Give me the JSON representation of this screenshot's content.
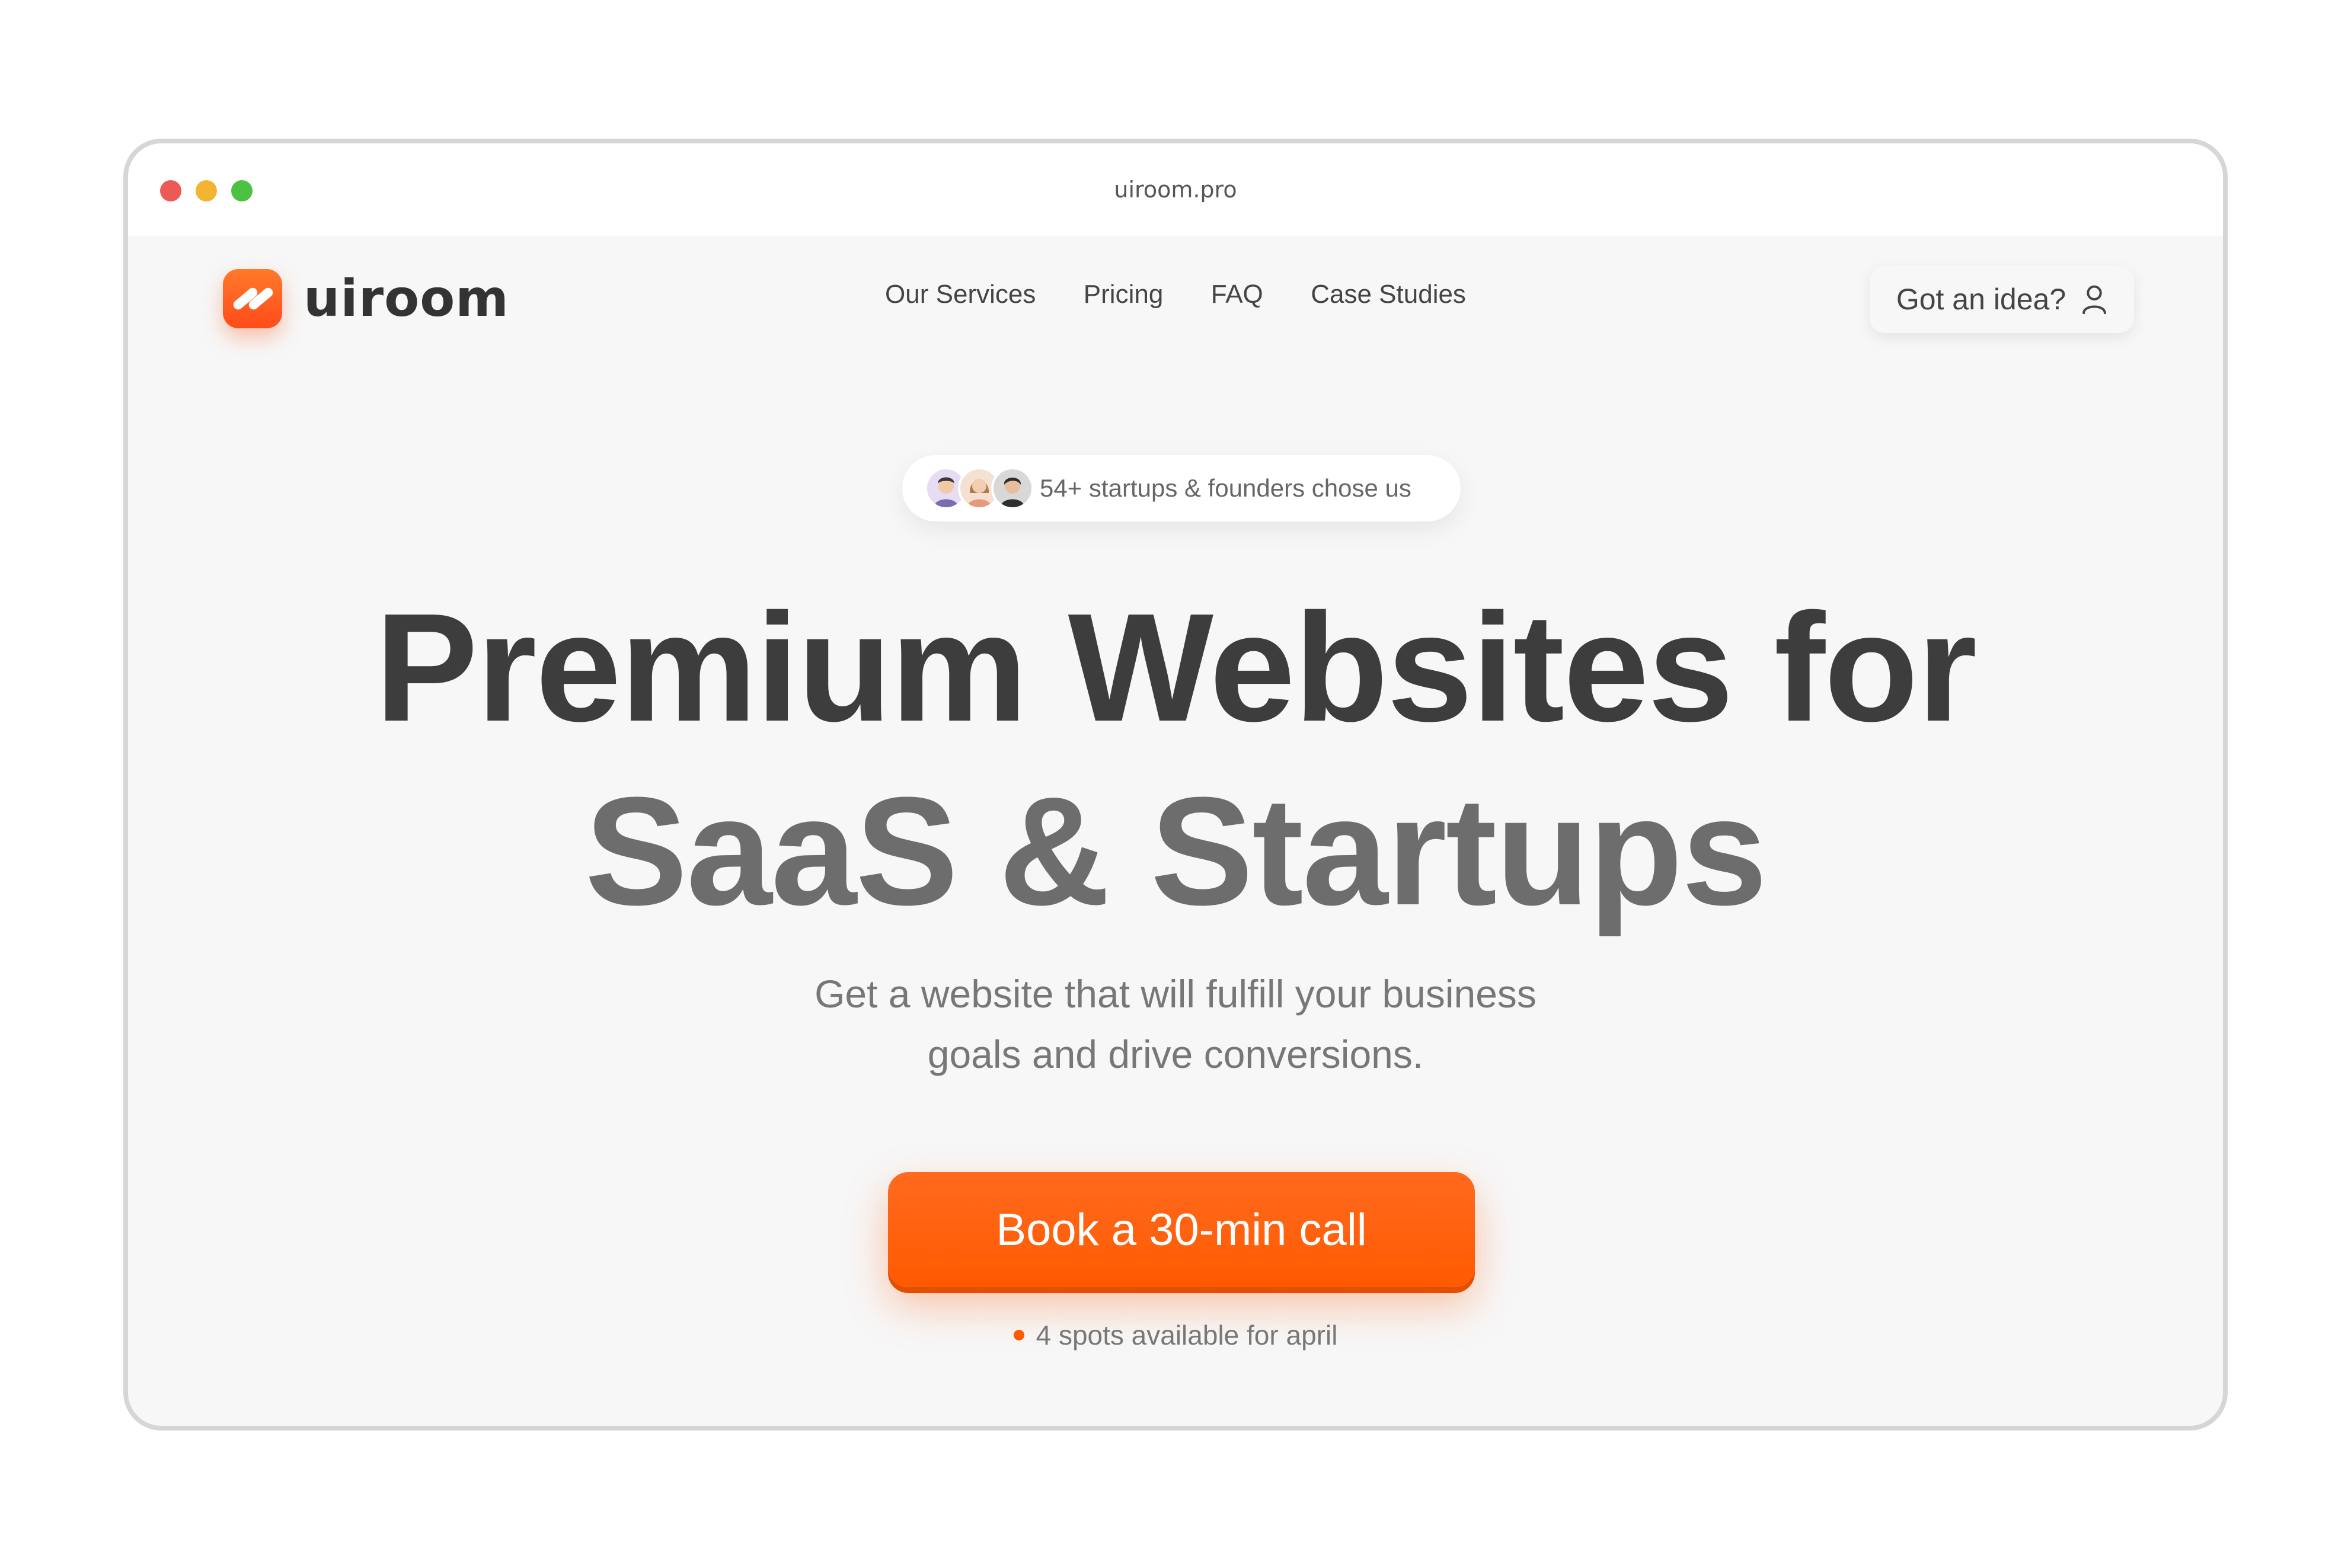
{
  "browser": {
    "url": "uiroom.pro"
  },
  "nav": {
    "brand": "uiroom",
    "links": [
      "Our Services",
      "Pricing",
      "FAQ",
      "Case Studies"
    ],
    "cta_label": "Got an idea?"
  },
  "hero": {
    "social_proof": "54+ startups & founders chose us",
    "title_line1": "Premium Websites for",
    "title_line2": "SaaS & Startups",
    "subtitle_line1": "Get a website that will fulfill your business",
    "subtitle_line2": "goals and drive conversions.",
    "cta_label": "Book a 30-min call",
    "availability": "4 spots available for april"
  },
  "colors": {
    "accent": "#ff5a00",
    "heading_dark": "#3d3d3d",
    "heading_light": "#6d6d6d",
    "background": "#f7f7f7"
  },
  "icons": {
    "traffic_lights": [
      "close-icon",
      "minimize-icon",
      "maximize-icon"
    ],
    "logo": "uiroom-logo-icon",
    "user": "user-icon"
  }
}
